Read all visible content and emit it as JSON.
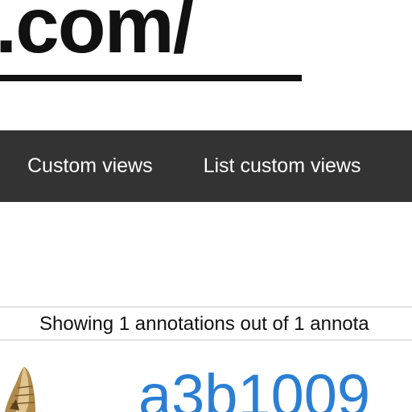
{
  "header": {
    "site_title": ".com/"
  },
  "nav": {
    "items": [
      {
        "label": "Custom views"
      },
      {
        "label": "List custom views"
      }
    ]
  },
  "status": {
    "text": "Showing 1 annotations out of 1 annota"
  },
  "annotation": {
    "id_text": "a3b1009",
    "link_color": "#2a7fd4"
  },
  "colors": {
    "navbar_bg": "#333333",
    "title_text": "#111111"
  }
}
